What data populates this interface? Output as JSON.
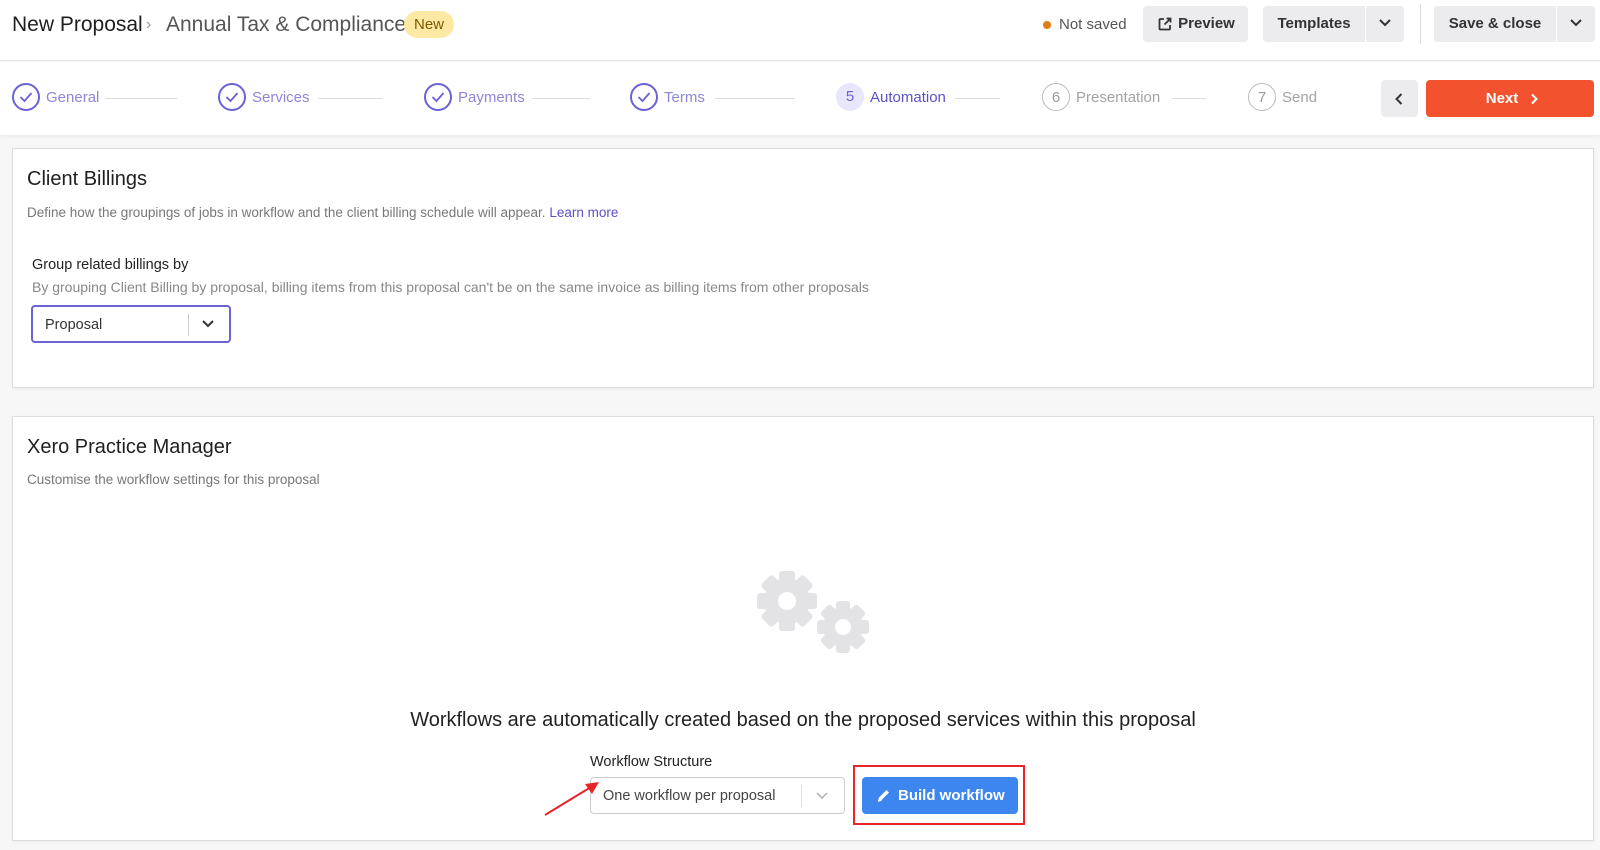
{
  "header": {
    "title": "New Proposal",
    "separator": "›",
    "subtitle": "Annual Tax & Compliance",
    "badge": "New",
    "save_status": "Not saved",
    "preview_label": "Preview",
    "templates_label": "Templates",
    "save_close_label": "Save & close"
  },
  "steps": [
    {
      "label": "General",
      "state": "done"
    },
    {
      "label": "Services",
      "state": "done"
    },
    {
      "label": "Payments",
      "state": "done"
    },
    {
      "label": "Terms",
      "state": "done"
    },
    {
      "number": "5",
      "label": "Automation",
      "state": "active"
    },
    {
      "number": "6",
      "label": "Presentation",
      "state": "todo"
    },
    {
      "number": "7",
      "label": "Send",
      "state": "todo"
    }
  ],
  "nav": {
    "next_label": "Next"
  },
  "client_billings": {
    "title": "Client Billings",
    "description": "Define how the groupings of jobs in workflow and the client billing schedule will appear.",
    "learn_more": "Learn more",
    "group_label": "Group related billings by",
    "group_help": "By grouping Client Billing by proposal, billing items from this proposal can't be on the same invoice as billing items from other proposals",
    "group_value": "Proposal"
  },
  "xpm": {
    "title": "Xero Practice Manager",
    "description": "Customise the workflow settings for this proposal",
    "empty_text": "Workflows are automatically created based on the proposed services within this proposal",
    "structure_label": "Workflow Structure",
    "structure_value": "One workflow per proposal",
    "build_label": "Build workflow"
  },
  "colors": {
    "accent": "#6b62d6",
    "next_button": "#f2522e",
    "build_button": "#3d86f0",
    "badge_bg": "#fde9a4",
    "status_dot": "#e07c10",
    "annotation": "#e8262a"
  },
  "icons": {
    "preview": "external-link-icon",
    "dropdown": "chevron-down-icon",
    "back": "chevron-left-icon",
    "next": "chevron-right-icon",
    "done_step": "check-icon",
    "empty_state": "gears-icon",
    "build": "pencil-icon"
  }
}
